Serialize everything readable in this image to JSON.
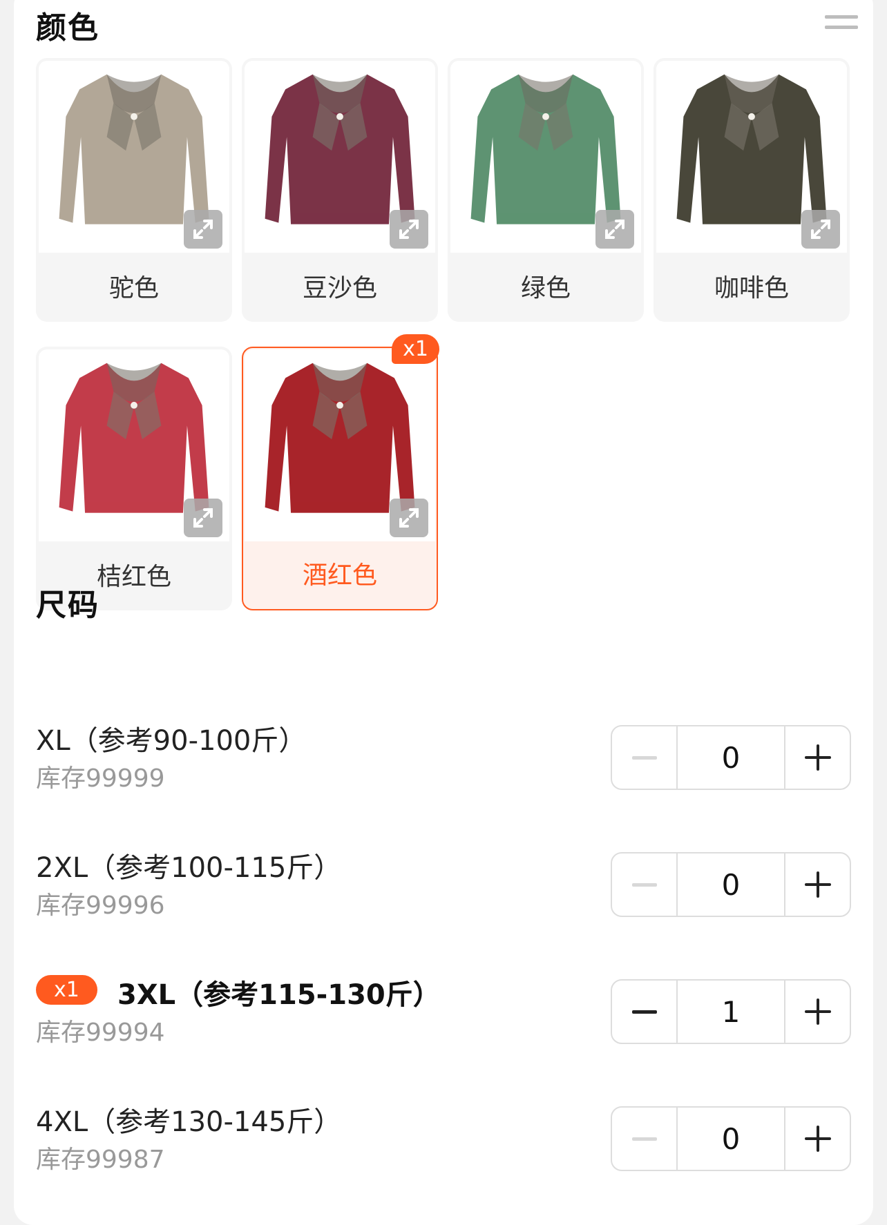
{
  "color_section": {
    "title": "颜色",
    "items": [
      {
        "label": "驼色",
        "swatch": "#b2a797",
        "selected": false
      },
      {
        "label": "豆沙色",
        "swatch": "#7b3347",
        "selected": false
      },
      {
        "label": "绿色",
        "swatch": "#5e9372",
        "selected": false
      },
      {
        "label": "咖啡色",
        "swatch": "#49473a",
        "selected": false
      },
      {
        "label": "桔红色",
        "swatch": "#c23c4a",
        "selected": false
      },
      {
        "label": "酒红色",
        "swatch": "#a8242a",
        "selected": true,
        "badge": "x1"
      }
    ]
  },
  "size_section": {
    "title": "尺码",
    "rows": [
      {
        "name": "XL（参考90-100斤）",
        "stock": "库存99999",
        "qty": "0",
        "badge": ""
      },
      {
        "name": "2XL（参考100-115斤）",
        "stock": "库存99996",
        "qty": "0",
        "badge": ""
      },
      {
        "name": "3XL（参考115-130斤）",
        "stock": "库存99994",
        "qty": "1",
        "badge": "x1"
      },
      {
        "name": "4XL（参考130-145斤）",
        "stock": "库存99987",
        "qty": "0",
        "badge": ""
      }
    ]
  },
  "colors": {
    "accent": "#ff5a1f",
    "selected_bg": "#fef1ec",
    "muted_text": "#999999"
  }
}
